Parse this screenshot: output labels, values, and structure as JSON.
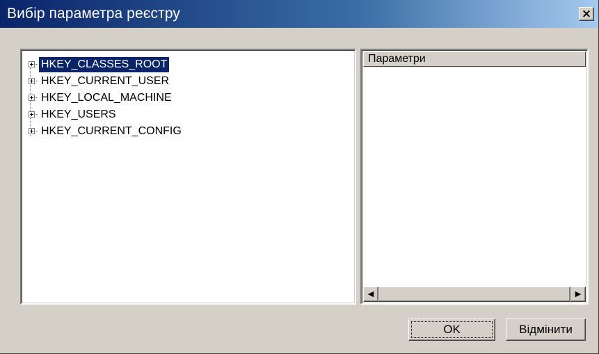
{
  "window": {
    "title": "Вибір параметра реєстру",
    "close_label": "×"
  },
  "tree": {
    "items": [
      {
        "label": "HKEY_CLASSES_ROOT",
        "selected": true
      },
      {
        "label": "HKEY_CURRENT_USER",
        "selected": false
      },
      {
        "label": "HKEY_LOCAL_MACHINE",
        "selected": false
      },
      {
        "label": "HKEY_USERS",
        "selected": false
      },
      {
        "label": "HKEY_CURRENT_CONFIG",
        "selected": false
      }
    ]
  },
  "params": {
    "header": "Параметри",
    "scroll_left": "◀",
    "scroll_right": "▶"
  },
  "buttons": {
    "ok": "OK",
    "cancel": "Відмінити"
  },
  "colors": {
    "selection": "#0a246a",
    "title_bar": "#0a246a",
    "face": "#d4d0c8"
  }
}
